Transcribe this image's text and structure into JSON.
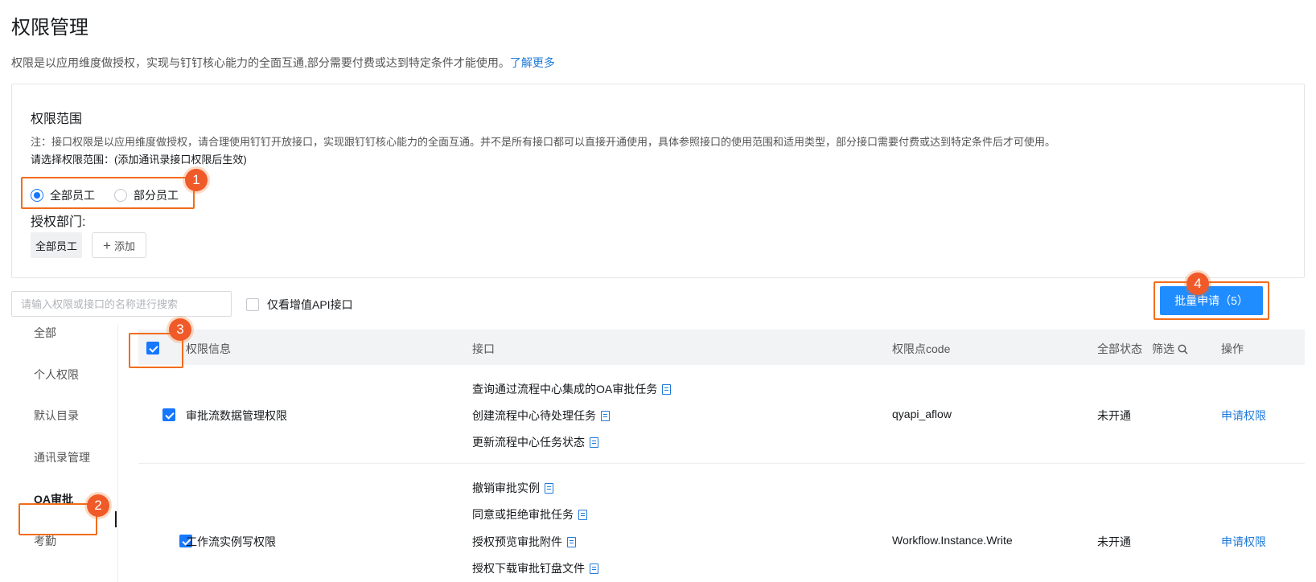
{
  "page": {
    "title": "权限管理",
    "description": "权限是以应用维度做授权，实现与钉钉核心能力的全面互通,部分需要付费或达到特定条件才能使用。",
    "learn_more": "了解更多"
  },
  "scope": {
    "title": "权限范围",
    "note": "注：接口权限是以应用维度做授权，请合理使用钉钉开放接口，实现跟钉钉核心能力的全面互通。并不是所有接口都可以直接开通使用，具体参照接口的使用范围和适用类型，部分接口需要付费或达到特定条件后才可使用。",
    "prompt": "请选择权限范围：(添加通讯录接口权限后生效)",
    "options": [
      {
        "label": "全部员工",
        "selected": true
      },
      {
        "label": "部分员工",
        "selected": false
      }
    ],
    "dept_label": "授权部门:",
    "dept_tag": "全部员工",
    "add_label": "添加"
  },
  "toolbar": {
    "search_placeholder": "请输入权限或接口的名称进行搜索",
    "value_added_only": "仅看增值API接口",
    "batch_apply": "批量申请（5）"
  },
  "sidebar": {
    "items": [
      {
        "label": "全部"
      },
      {
        "label": "个人权限"
      },
      {
        "label": "默认目录"
      },
      {
        "label": "通讯录管理"
      },
      {
        "label": "OA审批"
      },
      {
        "label": "考勤"
      }
    ],
    "active": "OA审批"
  },
  "table": {
    "columns": {
      "info": "权限信息",
      "api": "接口",
      "code": "权限点code",
      "status": "全部状态",
      "filter": "筛选",
      "action": "操作"
    },
    "rows": [
      {
        "checked": true,
        "name": "审批流数据管理权限",
        "apis": [
          "查询通过流程中心集成的OA审批任务",
          "创建流程中心待处理任务",
          "更新流程中心任务状态"
        ],
        "code": "qyapi_aflow",
        "status": "未开通",
        "action": "申请权限"
      },
      {
        "checked": true,
        "name": "工作流实例写权限",
        "apis": [
          "撤销审批实例",
          "同意或拒绝审批任务",
          "授权预览审批附件",
          "授权下载审批钉盘文件"
        ],
        "code": "Workflow.Instance.Write",
        "status": "未开通",
        "action": "申请权限"
      }
    ]
  },
  "annotations": [
    "1",
    "2",
    "3",
    "4"
  ],
  "colors": {
    "accent": "#1677ff",
    "link": "#1f7ad8",
    "annotation": "#f26c1b"
  }
}
